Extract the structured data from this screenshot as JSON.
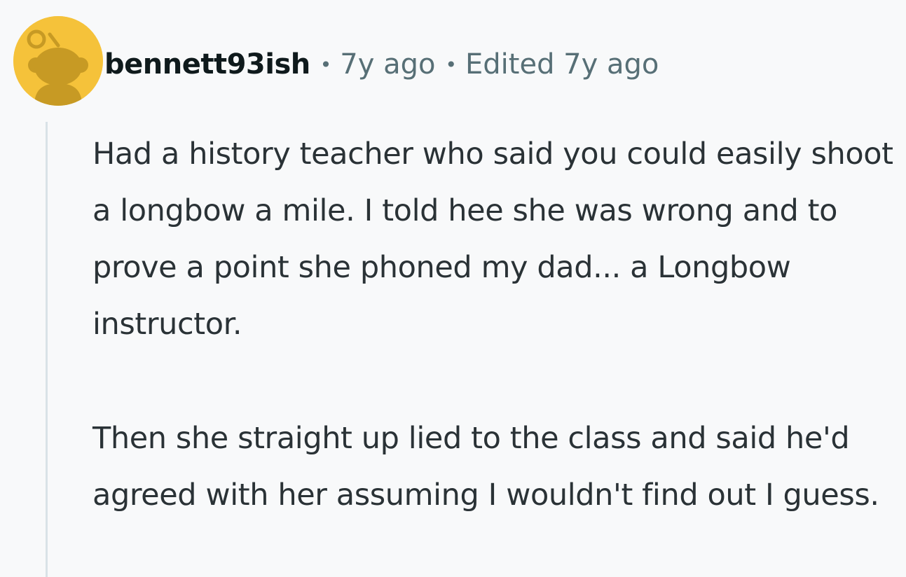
{
  "comment": {
    "author": "bennett93ish",
    "separator": "•",
    "age": "7y ago",
    "edited": "Edited 7y ago",
    "avatar_icon": "reddit-snoo-avatar-icon",
    "paragraphs": [
      "Had a history teacher who said you could easily shoot a longbow a mile. I told hee she was wrong and to prove a point she phoned my dad... a Longbow instructor.",
      "Then she straight up lied to the class and said he'd agreed with her assuming I wouldn't find out I guess."
    ]
  },
  "colors": {
    "background": "#f8f9fa",
    "avatar_bg": "#f5c23a",
    "avatar_figure": "#c79a24",
    "author": "#0f1a1c",
    "meta": "#576f76",
    "body_text": "#2a3236",
    "thread_line": "#d9e2e7"
  }
}
